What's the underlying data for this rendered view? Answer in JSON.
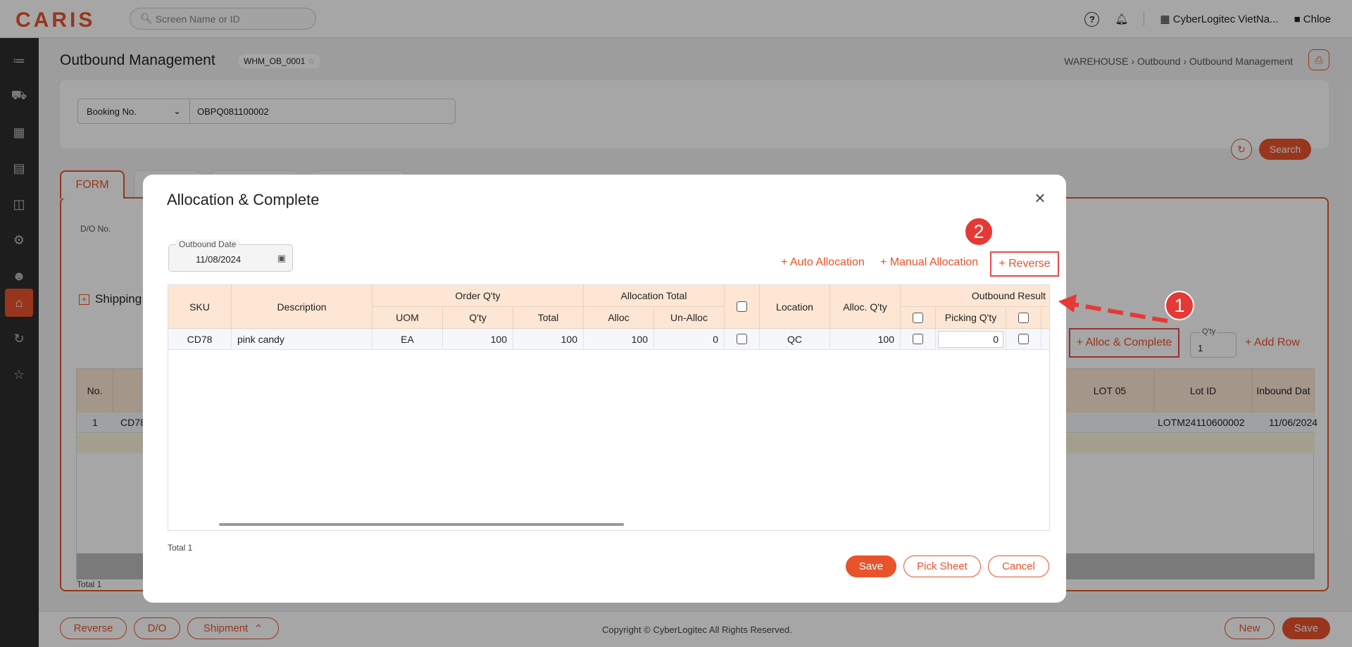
{
  "header": {
    "logo": "CARIS",
    "search_placeholder": "Screen Name or ID",
    "company": "CyberLogitec VietNa...",
    "user": "Chloe"
  },
  "sidebar": {
    "items": [
      "dashboard",
      "truck",
      "billing",
      "document",
      "warehouse-boxes",
      "database-settings",
      "user-settings",
      "warehouse",
      "history",
      "favorites"
    ],
    "active_index": 7
  },
  "page": {
    "title": "Outbound Management",
    "code": "WHM_OB_0001",
    "breadcrumb": [
      "WAREHOUSE",
      "Outbound",
      "Outbound Management"
    ]
  },
  "filter": {
    "type": "Booking No.",
    "value": "OBPQ081100002",
    "search_label": "Search"
  },
  "form": {
    "tab_label": "FORM",
    "do_label": "D/O No.",
    "section_label": "Shipping",
    "alloc_complete_label": "+ Alloc & Complete",
    "qty_label": "Q'ty",
    "qty_value": "1",
    "add_row_label": "+ Add Row",
    "table": {
      "headers": [
        "No.",
        "LOT 05",
        "Lot ID",
        "Inbound Dat"
      ],
      "row": {
        "no": "1",
        "sku": "CD78",
        "lot_id": "LOTM24110600002",
        "inbound_date": "11/06/2024"
      }
    },
    "total": "Total 1"
  },
  "footer": {
    "reverse": "Reverse",
    "do": "D/O",
    "shipment": "Shipment",
    "copyright": "Copyright © CyberLogitec All Rights Reserved.",
    "new": "New",
    "save": "Save"
  },
  "modal": {
    "title": "Allocation & Complete",
    "outbound_date_label": "Outbound Date",
    "outbound_date": "11/08/2024",
    "actions": {
      "auto": "+ Auto Allocation",
      "manual": "+ Manual Allocation",
      "reverse": "+ Reverse"
    },
    "grid": {
      "headers": {
        "sku": "SKU",
        "description": "Description",
        "order_qty": "Order Q'ty",
        "uom": "UOM",
        "qty": "Q'ty",
        "total": "Total",
        "alloc_total": "Allocation Total",
        "alloc": "Alloc",
        "un_alloc": "Un-Alloc",
        "location": "Location",
        "alloc_qty": "Alloc. Q'ty",
        "outbound_result": "Outbound Result",
        "picking_qty": "Picking Q'ty"
      },
      "row": {
        "sku": "CD78",
        "description": "pink candy",
        "uom": "EA",
        "qty": "100",
        "total": "100",
        "alloc": "100",
        "un_alloc": "0",
        "location": "QC",
        "alloc_qty": "100",
        "picking_qty": "0"
      }
    },
    "total": "Total 1",
    "buttons": {
      "save": "Save",
      "pick_sheet": "Pick Sheet",
      "cancel": "Cancel"
    }
  },
  "annotations": {
    "step1": "1",
    "step2": "2"
  },
  "colors": {
    "accent": "#e8532b",
    "highlight": "#e84a4a",
    "header_bg": "#fde7d4"
  }
}
